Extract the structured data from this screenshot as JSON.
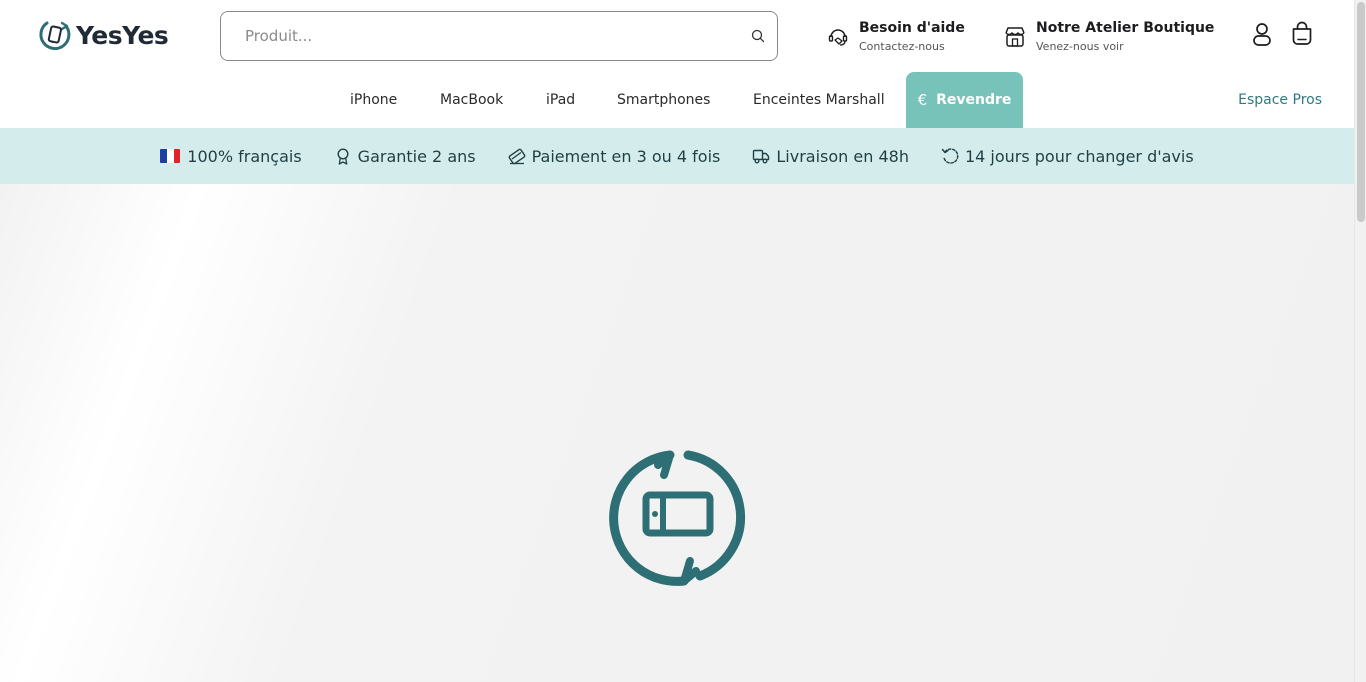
{
  "brand": {
    "name": "YesYes",
    "primary_color": "#2d6f74",
    "accent_color": "#78c3b9",
    "logo_icon": "refurbished-phone-logo-icon"
  },
  "search": {
    "placeholder": "Produit...",
    "icon": "search-icon"
  },
  "help": {
    "title": "Besoin d'aide",
    "subtitle": "Contactez-nous",
    "icon": "customer-support-icon"
  },
  "store": {
    "title": "Notre Atelier Boutique",
    "subtitle": "Venez-nous voir",
    "icon": "storefront-icon"
  },
  "header_actions": {
    "account_icon": "user-account-icon",
    "cart_icon": "shopping-bag-icon"
  },
  "nav": {
    "items": [
      {
        "label": "iPhone"
      },
      {
        "label": "MacBook"
      },
      {
        "label": "iPad"
      },
      {
        "label": "Smartphones"
      },
      {
        "label": "Enceintes Marshall"
      }
    ],
    "revendre": {
      "symbol": "€",
      "label": "Revendre"
    },
    "pros_label": "Espace Pros"
  },
  "benefits": [
    {
      "label": "100% français",
      "icon": "france-flag-icon"
    },
    {
      "label": "Garantie 2 ans",
      "icon": "award-ribbon-icon"
    },
    {
      "label": "Paiement en 3 ou 4 fois",
      "icon": "credit-card-icon"
    },
    {
      "label": "Livraison en 48h",
      "icon": "delivery-truck-icon"
    },
    {
      "label": "14 jours pour changer d'avis",
      "icon": "return-arrow-icon"
    }
  ],
  "colors": {
    "benefits_background": "#d5ecec",
    "benefit_text": "#1f3f44",
    "pros_link": "#2f7a80"
  }
}
